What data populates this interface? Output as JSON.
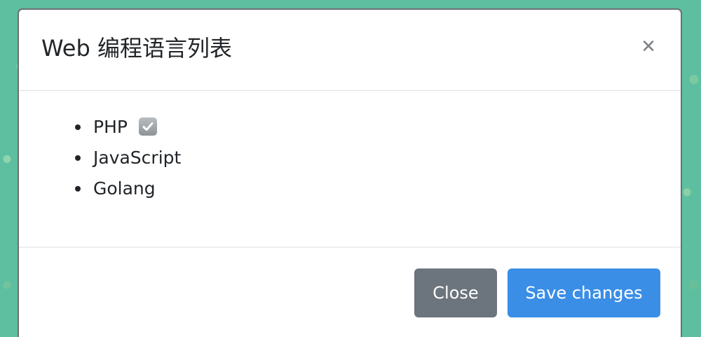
{
  "modal": {
    "title": "Web 编程语言列表",
    "close_symbol": "×"
  },
  "languages": [
    {
      "label": "PHP",
      "checked": true,
      "icon": "check-box-icon"
    },
    {
      "label": "JavaScript",
      "checked": false
    },
    {
      "label": "Golang",
      "checked": false
    }
  ],
  "footer": {
    "close_label": "Close",
    "save_label": "Save changes"
  },
  "colors": {
    "backdrop": "#5dbf9f",
    "secondary_button": "#6c757d",
    "primary_button": "#3a8ee6"
  }
}
